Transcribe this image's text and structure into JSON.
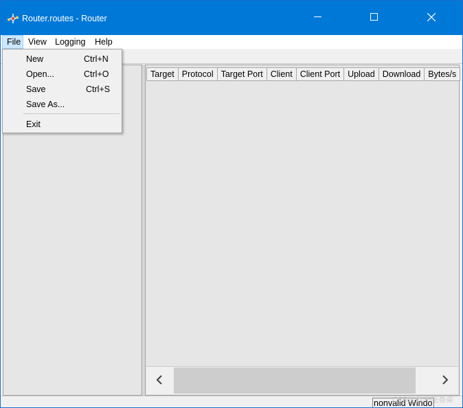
{
  "window": {
    "title": "Router.routes - Router",
    "accent_color": "#0078d7",
    "icon": "router-app-icon"
  },
  "titlebar_buttons": {
    "minimize_icon": "minimize-icon",
    "maximize_icon": "maximize-icon",
    "close_icon": "close-icon"
  },
  "menubar": {
    "items": [
      {
        "label": "File",
        "active": true
      },
      {
        "label": "View"
      },
      {
        "label": "Logging"
      },
      {
        "label": "Help"
      }
    ]
  },
  "file_menu": {
    "items": [
      {
        "label": "New",
        "shortcut": "Ctrl+N"
      },
      {
        "label": "Open...",
        "shortcut": "Ctrl+O"
      },
      {
        "label": "Save",
        "shortcut": "Ctrl+S"
      },
      {
        "label": "Save As...",
        "shortcut": ""
      },
      {
        "label": "Exit",
        "shortcut": ""
      }
    ]
  },
  "table": {
    "columns": [
      "Target",
      "Protocol",
      "Target Port",
      "Client",
      "Client Port",
      "Upload",
      "Download",
      "Bytes/s"
    ],
    "rows": []
  },
  "scrollbar": {
    "left_icon": "chevron-left-icon",
    "right_icon": "chevron-right-icon"
  },
  "statusbar": {
    "text": "nonvalid Windo"
  },
  "watermark": "CSDN @不吃香菜"
}
